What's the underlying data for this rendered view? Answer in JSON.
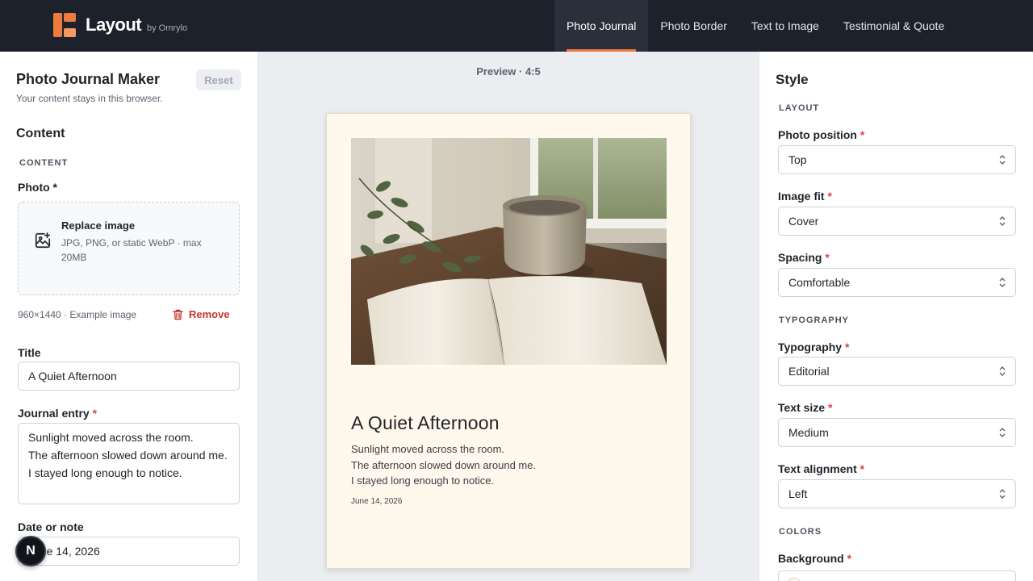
{
  "header": {
    "brand": "Layout",
    "brand_sub": "by Omrylo",
    "tabs": [
      {
        "label": "Photo Journal"
      },
      {
        "label": "Photo Border"
      },
      {
        "label": "Text to Image"
      },
      {
        "label": "Testimonial & Quote"
      }
    ],
    "accent_color": "#ef7a3d"
  },
  "left": {
    "title": "Photo Journal Maker",
    "subtitle": "Your content stays in this browser.",
    "reset_label": "Reset",
    "section_heading": "Content",
    "section_caption": "CONTENT",
    "photo_label": "Photo *",
    "upload_title": "Replace image",
    "upload_hint": "JPG, PNG, or static WebP · max 20MB",
    "image_meta": "960×1440 · Example image",
    "remove_label": "Remove",
    "title_label": "Title",
    "title_value": "A Quiet Afternoon",
    "entry_label": "Journal entry",
    "entry_lines": [
      "Sunlight moved across the room.",
      "The afternoon slowed down around me.",
      "I stayed long enough to notice."
    ],
    "date_label": "Date or note",
    "date_value": "June 14, 2026",
    "fab_label": "N"
  },
  "preview": {
    "label": "Preview · 4:5",
    "card_title": "A Quiet Afternoon",
    "card_lines": [
      "Sunlight moved across the room.",
      "The afternoon slowed down around me.",
      "I stayed long enough to notice."
    ],
    "card_date": "June 14, 2026",
    "card_background": "#fff8ec"
  },
  "style": {
    "title": "Style",
    "layout_caption": "LAYOUT",
    "photo_position_label": "Photo position",
    "photo_position_value": "Top",
    "image_fit_label": "Image fit",
    "image_fit_value": "Cover",
    "spacing_label": "Spacing",
    "spacing_value": "Comfortable",
    "typography_caption": "TYPOGRAPHY",
    "typography_label": "Typography",
    "typography_value": "Editorial",
    "text_size_label": "Text size",
    "text_size_value": "Medium",
    "text_align_label": "Text alignment",
    "text_align_value": "Left",
    "colors_caption": "COLORS",
    "background_label": "Background",
    "background_value": "#FFF8EE"
  },
  "icons": {
    "upload": "image-plus-icon",
    "remove": "trash-icon",
    "select": "chevron-updown-icon"
  }
}
